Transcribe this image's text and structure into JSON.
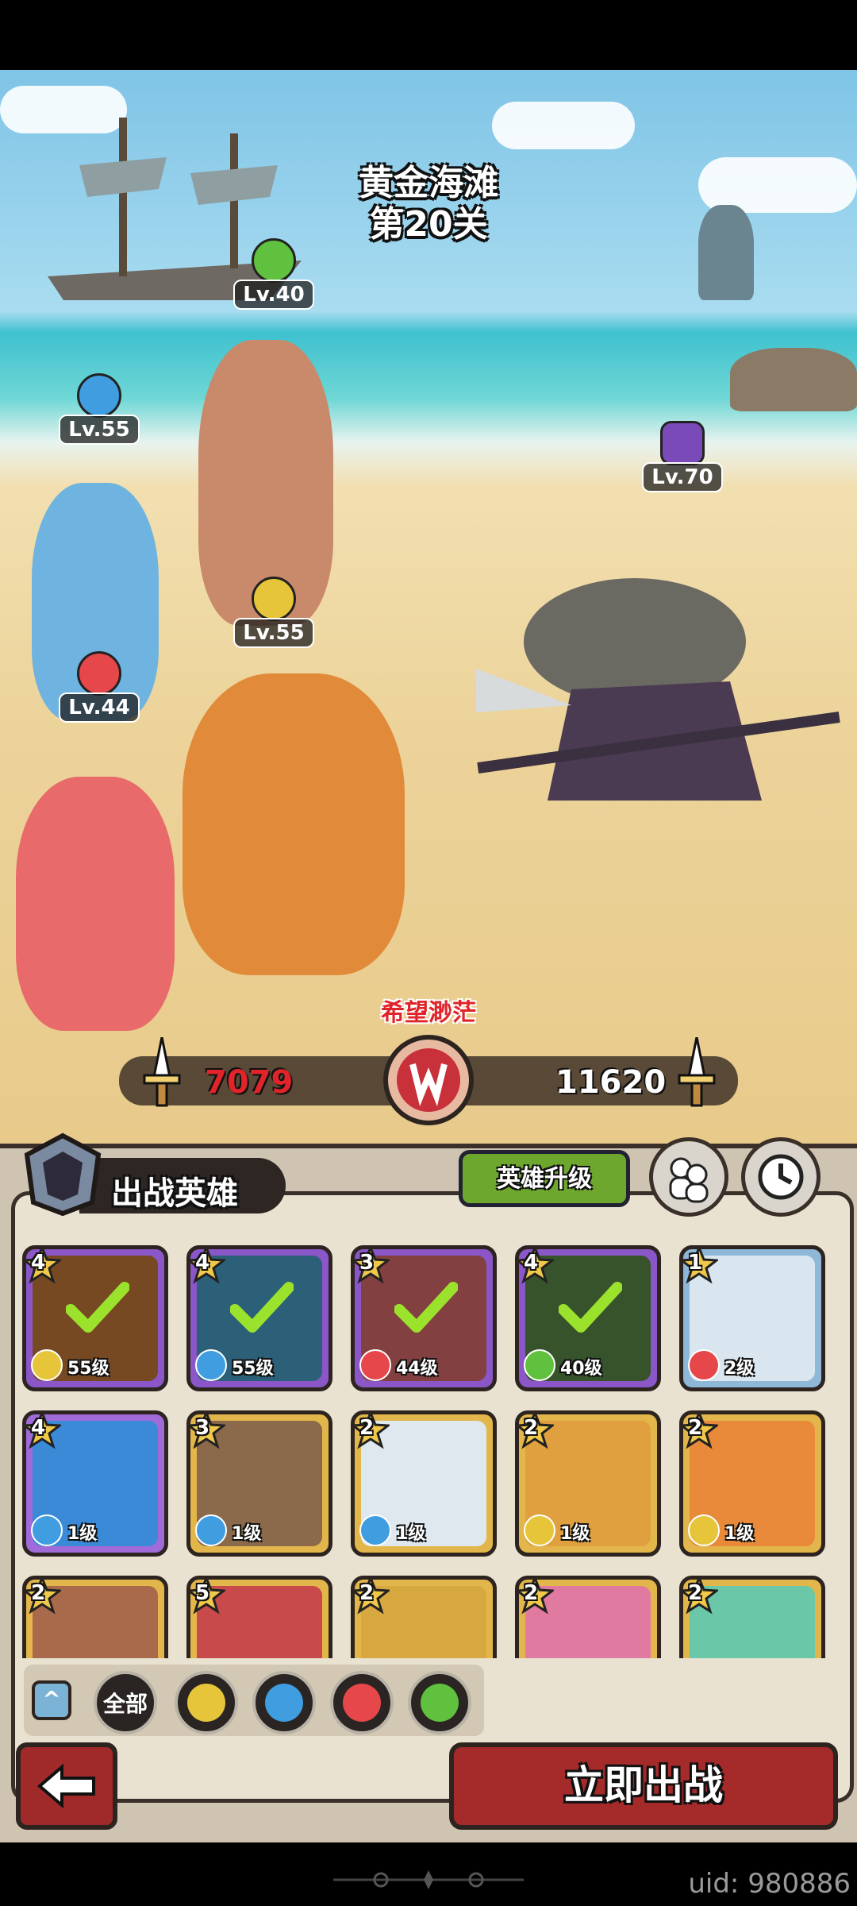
{
  "stage": {
    "name": "黄金海滩",
    "level": "第20关"
  },
  "heroes_field": [
    {
      "level": "Lv.40",
      "element": "nature"
    },
    {
      "level": "Lv.55",
      "element": "water"
    },
    {
      "level": "Lv.55",
      "element": "earth"
    },
    {
      "level": "Lv.44",
      "element": "fire"
    }
  ],
  "enemy": {
    "level": "Lv.70",
    "element": "dark"
  },
  "battle": {
    "emblem_label": "希望渺茫",
    "our_power": "7079",
    "enemy_power": "11620"
  },
  "panel": {
    "title": "出战英雄",
    "upgrade_button": "英雄升级"
  },
  "hero_cards": [
    {
      "stars": "4",
      "level": "55级",
      "element": "earth",
      "selected": true,
      "color": "#c47a3a",
      "frame": "#8a56c8"
    },
    {
      "stars": "4",
      "level": "55级",
      "element": "water",
      "selected": true,
      "color": "#4aa0c8",
      "frame": "#8a56c8"
    },
    {
      "stars": "3",
      "level": "44级",
      "element": "fire",
      "selected": true,
      "color": "#d86a6a",
      "frame": "#8a56c8"
    },
    {
      "stars": "4",
      "level": "40级",
      "element": "nature",
      "selected": true,
      "color": "#5a8a4a",
      "frame": "#8a56c8"
    },
    {
      "stars": "1",
      "level": "2级",
      "element": "fire",
      "selected": false,
      "color": "#d9e6ef",
      "frame": "#8fb8d8"
    },
    {
      "stars": "4",
      "level": "1级",
      "element": "water",
      "selected": false,
      "color": "#3a8ad8",
      "frame": "#a06ad8"
    },
    {
      "stars": "3",
      "level": "1级",
      "element": "water",
      "selected": false,
      "color": "#8a6a4a",
      "frame": "#e2b64a"
    },
    {
      "stars": "2",
      "level": "1级",
      "element": "water",
      "selected": false,
      "color": "#dfe8ef",
      "frame": "#e2b64a"
    },
    {
      "stars": "2",
      "level": "1级",
      "element": "earth",
      "selected": false,
      "color": "#e0a040",
      "frame": "#e2b64a"
    },
    {
      "stars": "2",
      "level": "1级",
      "element": "earth",
      "selected": false,
      "color": "#e88a3a",
      "frame": "#e2b64a"
    },
    {
      "stars": "2",
      "level": "",
      "element": "",
      "selected": false,
      "color": "#a86a4a",
      "frame": "#e2b64a"
    },
    {
      "stars": "5",
      "level": "",
      "element": "",
      "selected": false,
      "color": "#c84a4a",
      "frame": "#e2b64a"
    },
    {
      "stars": "2",
      "level": "",
      "element": "",
      "selected": false,
      "color": "#d8a840",
      "frame": "#e2b64a"
    },
    {
      "stars": "2",
      "level": "",
      "element": "",
      "selected": false,
      "color": "#e07aa0",
      "frame": "#e2b64a"
    },
    {
      "stars": "2",
      "level": "",
      "element": "",
      "selected": false,
      "color": "#6ac8a8",
      "frame": "#e2b64a"
    }
  ],
  "filters": {
    "collapse_icon": "^",
    "all_label": "全部",
    "elements": [
      "earth",
      "water",
      "fire",
      "nature"
    ]
  },
  "actions": {
    "go_button": "立即出战",
    "back_icon": "back-arrow-icon"
  },
  "footer": {
    "uid": "uid: 980886"
  },
  "colors": {
    "earth": "#e6c53a",
    "water": "#3f9de0",
    "fire": "#e5474a",
    "nature": "#5fc13d",
    "dark": "#7a4ab8"
  }
}
